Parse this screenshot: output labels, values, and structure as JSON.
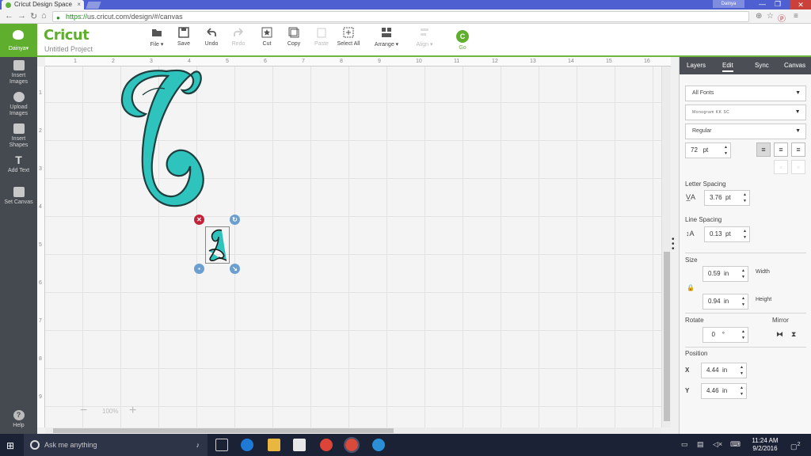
{
  "browser": {
    "tab_title": "Cricut Design Space",
    "tab_close": "×",
    "user_chip": "Dainya",
    "window_buttons": [
      "—",
      "❐",
      "✕"
    ],
    "url_scheme": "https://",
    "url_rest": "us.cricut.com/design/#/canvas"
  },
  "app": {
    "user_name": "Dainya",
    "logo": "Cricut",
    "project_name": "Untitled Project",
    "toolbar": {
      "file": "File",
      "save": "Save",
      "undo": "Undo",
      "redo": "Redo",
      "cut": "Cut",
      "copy": "Copy",
      "paste": "Paste",
      "select_all": "Select All",
      "arrange": "Arrange",
      "align": "Align",
      "go": "Go",
      "go_glyph": "C"
    }
  },
  "sidebar": {
    "items": [
      {
        "label_1": "Insert",
        "label_2": "Images"
      },
      {
        "label_1": "Upload",
        "label_2": "Images"
      },
      {
        "label_1": "Insert",
        "label_2": "Shapes"
      },
      {
        "label_1": "Add Text",
        "label_2": ""
      },
      {
        "label_1": "Set Canvas",
        "label_2": ""
      }
    ],
    "help": "Help"
  },
  "canvas": {
    "ruler_x": [
      "1",
      "2",
      "3",
      "4",
      "5",
      "6",
      "7",
      "8",
      "9",
      "10",
      "11",
      "12",
      "13",
      "14",
      "15",
      "16"
    ],
    "ruler_y": [
      "1",
      "2",
      "3",
      "4",
      "5",
      "6",
      "7",
      "8",
      "9"
    ],
    "zoom": "100%",
    "zoom_minus": "−",
    "zoom_plus": "+",
    "monogram_big": "C",
    "monogram_small": "L",
    "monogram_color": "#2ec4bd"
  },
  "panel": {
    "tabs": [
      "Layers",
      "Edit",
      "Sync",
      "Canvas"
    ],
    "active_tab": "Edit",
    "font_filter": "All Fonts",
    "font_name": "Monogram KK SC",
    "font_style": "Regular",
    "font_size": "72",
    "font_unit": "pt",
    "letter_spacing_label": "Letter Spacing",
    "letter_spacing": "3.76",
    "line_spacing_label": "Line Spacing",
    "line_spacing": "0.13",
    "size_label": "Size",
    "width": "0.59",
    "height": "0.94",
    "size_unit": "in",
    "width_label": "Width",
    "height_label": "Height",
    "rotate_label": "Rotate",
    "rotate": "0",
    "rotate_unit": "°",
    "mirror_label": "Mirror",
    "position_label": "Position",
    "x_label": "X",
    "y_label": "Y",
    "pos_x": "4.44",
    "pos_y": "4.46"
  },
  "taskbar": {
    "search_placeholder": "Ask me anything",
    "time": "11:24 AM",
    "date": "9/2/2016",
    "notif_count": "2"
  }
}
